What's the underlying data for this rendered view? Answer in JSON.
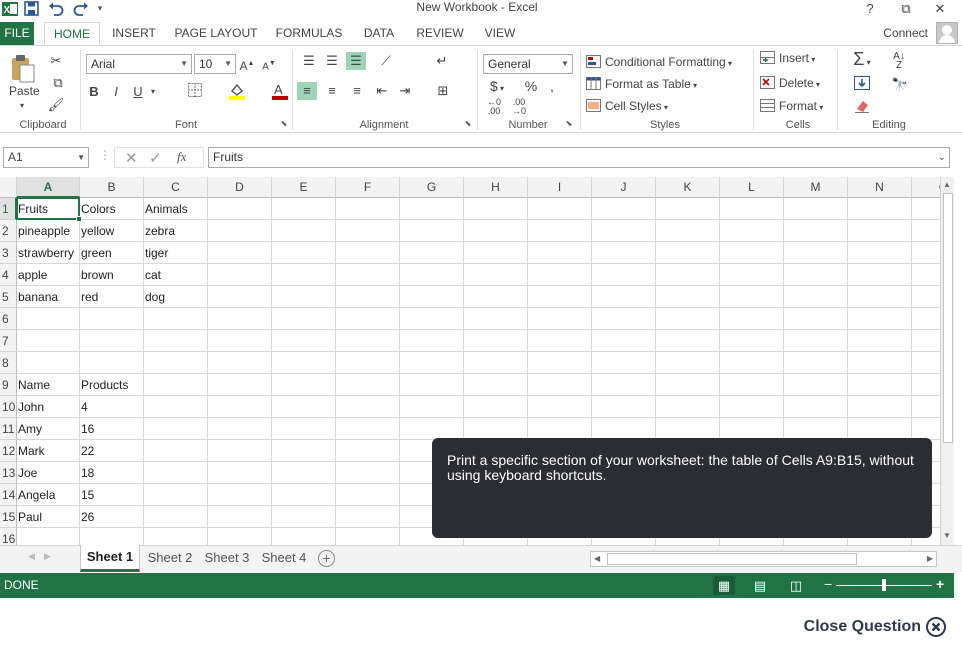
{
  "window": {
    "title": "New Workbook - Excel",
    "help_icon": "?",
    "restore_icon": "⧉",
    "close_icon": "✕"
  },
  "tabs": [
    {
      "label": "FILE"
    },
    {
      "label": "HOME"
    },
    {
      "label": "INSERT"
    },
    {
      "label": "PAGE LAYOUT"
    },
    {
      "label": "FORMULAS"
    },
    {
      "label": "DATA"
    },
    {
      "label": "REVIEW"
    },
    {
      "label": "VIEW"
    }
  ],
  "account": {
    "label": "Connect"
  },
  "ribbon": {
    "clipboard": {
      "paste_label": "Paste",
      "group_label": "Clipboard"
    },
    "font": {
      "name": "Arial",
      "size": "10",
      "group_label": "Font",
      "bold": "B",
      "italic": "I",
      "underline": "U"
    },
    "alignment": {
      "group_label": "Alignment"
    },
    "number": {
      "format": "General",
      "currency": "$",
      "percent": "%",
      "comma": ",",
      "group_label": "Number"
    },
    "styles": {
      "conditional_formatting": "Conditional Formatting",
      "format_as_table": "Format as Table",
      "cell_styles": "Cell Styles",
      "group_label": "Styles"
    },
    "cells": {
      "insert": "Insert",
      "delete": "Delete",
      "format": "Format",
      "group_label": "Cells"
    },
    "editing": {
      "group_label": "Editing"
    }
  },
  "formula_bar": {
    "name_box": "A1",
    "fx_label": "fx",
    "value": "Fruits"
  },
  "grid": {
    "columns": [
      "A",
      "B",
      "C",
      "D",
      "E",
      "F",
      "G",
      "H",
      "I",
      "J",
      "K",
      "L",
      "M",
      "N",
      "O"
    ],
    "rows": [
      "1",
      "2",
      "3",
      "4",
      "5",
      "6",
      "7",
      "8",
      "9",
      "10",
      "11",
      "12",
      "13",
      "14",
      "15",
      "16"
    ],
    "cells": [
      [
        "Fruits",
        "Colors",
        "Animals"
      ],
      [
        "pineapple",
        "yellow",
        "zebra"
      ],
      [
        "strawberry",
        "green",
        "tiger"
      ],
      [
        "apple",
        "brown",
        "cat"
      ],
      [
        "banana",
        "red",
        "dog"
      ],
      [
        "",
        "",
        ""
      ],
      [
        "",
        "",
        ""
      ],
      [
        "",
        "",
        ""
      ],
      [
        "Name",
        "Products",
        ""
      ],
      [
        "John",
        "4",
        ""
      ],
      [
        "Amy",
        "16",
        ""
      ],
      [
        "Mark",
        "22",
        ""
      ],
      [
        "Joe",
        "18",
        ""
      ],
      [
        "Angela",
        "15",
        ""
      ],
      [
        "Paul",
        "26",
        ""
      ],
      [
        "",
        "",
        ""
      ]
    ]
  },
  "sheets": [
    {
      "label": "Sheet 1"
    },
    {
      "label": "Sheet 2"
    },
    {
      "label": "Sheet 3"
    },
    {
      "label": "Sheet 4"
    }
  ],
  "status": {
    "text": "DONE"
  },
  "tooltip": {
    "text": "Print a specific section of your worksheet: the table of Cells A9:B15, without using keyboard shortcuts."
  },
  "close_question": {
    "label": "Close Question"
  },
  "colors": {
    "accent": "#217346",
    "tooltip_bg": "#2b2d33",
    "close_text": "#2f3b4c"
  }
}
